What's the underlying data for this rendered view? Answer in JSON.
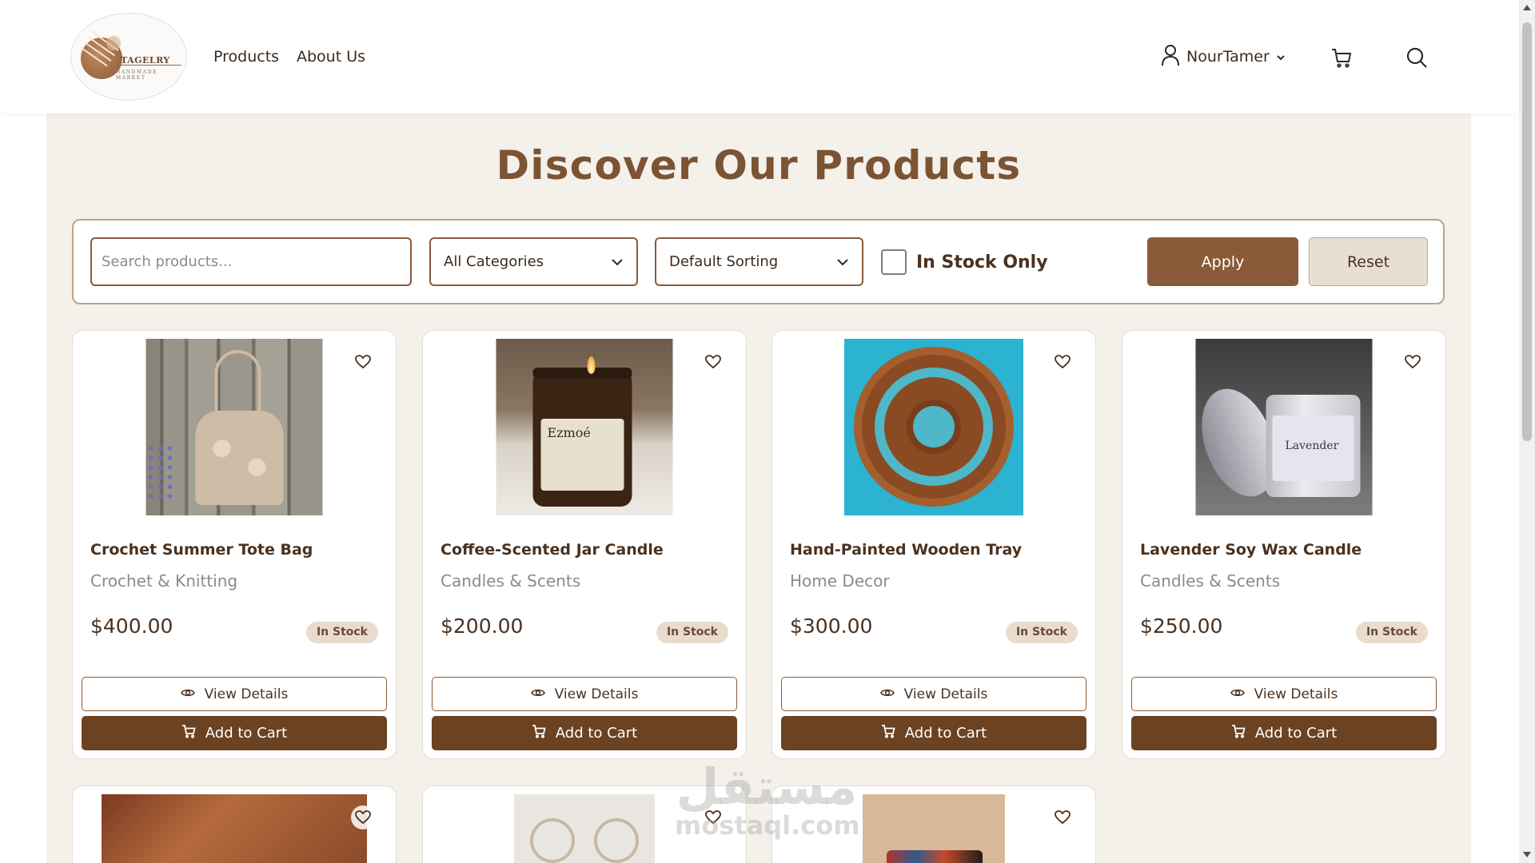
{
  "brand": {
    "logo_name": "TAGELRY",
    "logo_tagline": "HANDMADE MARKET"
  },
  "nav": {
    "products": "Products",
    "about": "About Us"
  },
  "user": {
    "name": "NourTamer"
  },
  "icons": {
    "user": "user-icon",
    "cart": "cart-icon",
    "search": "search-icon",
    "heart": "heart-icon",
    "eye": "eye-icon",
    "chevron": "chevron-down-icon"
  },
  "page": {
    "title": "Discover Our Products"
  },
  "filters": {
    "search_placeholder": "Search products...",
    "category_selected": "All Categories",
    "sort_selected": "Default Sorting",
    "in_stock_label": "In Stock Only",
    "in_stock_checked": false,
    "apply_label": "Apply",
    "reset_label": "Reset"
  },
  "buttons": {
    "view_details": "View Details",
    "add_to_cart": "Add to Cart"
  },
  "products": [
    {
      "name": "Crochet Summer Tote Bag",
      "category": "Crochet & Knitting",
      "price": "$400.00",
      "stock": "In Stock"
    },
    {
      "name": "Coffee-Scented Jar Candle",
      "category": "Candles & Scents",
      "price": "$200.00",
      "stock": "In Stock"
    },
    {
      "name": "Hand-Painted Wooden Tray",
      "category": "Home Decor",
      "price": "$300.00",
      "stock": "In Stock"
    },
    {
      "name": "Lavender Soy Wax Candle",
      "category": "Candles & Scents",
      "price": "$250.00",
      "stock": "In Stock"
    }
  ],
  "product_image_text": {
    "candle_label": "Ezmoé",
    "lavender_label": "Lavender"
  },
  "watermark": {
    "arabic": "مستقل",
    "latin": "mostaql.com"
  },
  "colors": {
    "brand_brown": "#8b5a38",
    "dark_brown": "#6b4222",
    "title_brown": "#7b5434",
    "background": "#f4f0ea",
    "badge_bg": "#e9dccd"
  }
}
